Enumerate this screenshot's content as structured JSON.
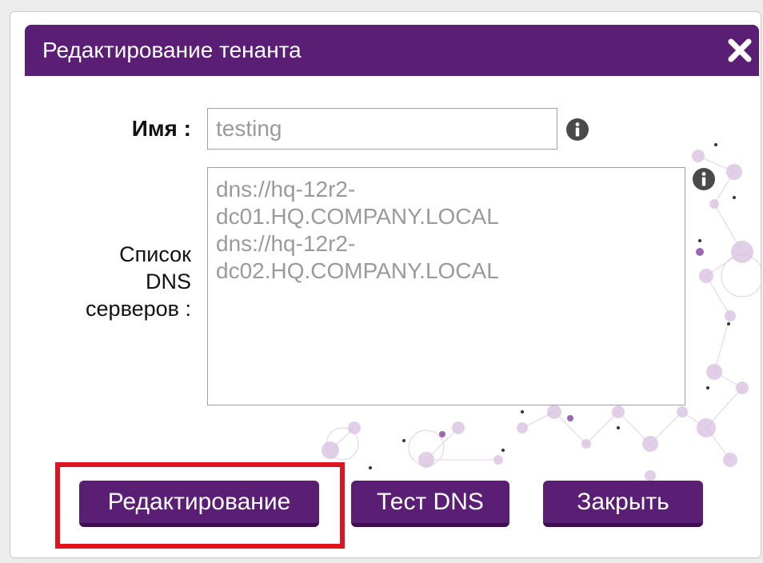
{
  "dialog": {
    "title": "Редактирование тенанта",
    "close_icon": "close-x-icon"
  },
  "form": {
    "name_label": "Имя :",
    "name_value": "testing",
    "dns_label_lines": [
      "Список",
      "DNS",
      "серверов :"
    ],
    "dns_value": "dns://hq-12r2-\ndc01.HQ.COMPANY.LOCAL\ndns://hq-12r2-\ndc02.HQ.COMPANY.LOCAL",
    "info_icon": "info-icon"
  },
  "buttons": {
    "edit_label": "Редактирование",
    "test_dns_label": "Тест DNS",
    "close_label": "Закрыть"
  },
  "colors": {
    "brand_purple": "#5a1e74",
    "highlight_red": "#e0141e",
    "muted_text": "#9a9a9a"
  }
}
